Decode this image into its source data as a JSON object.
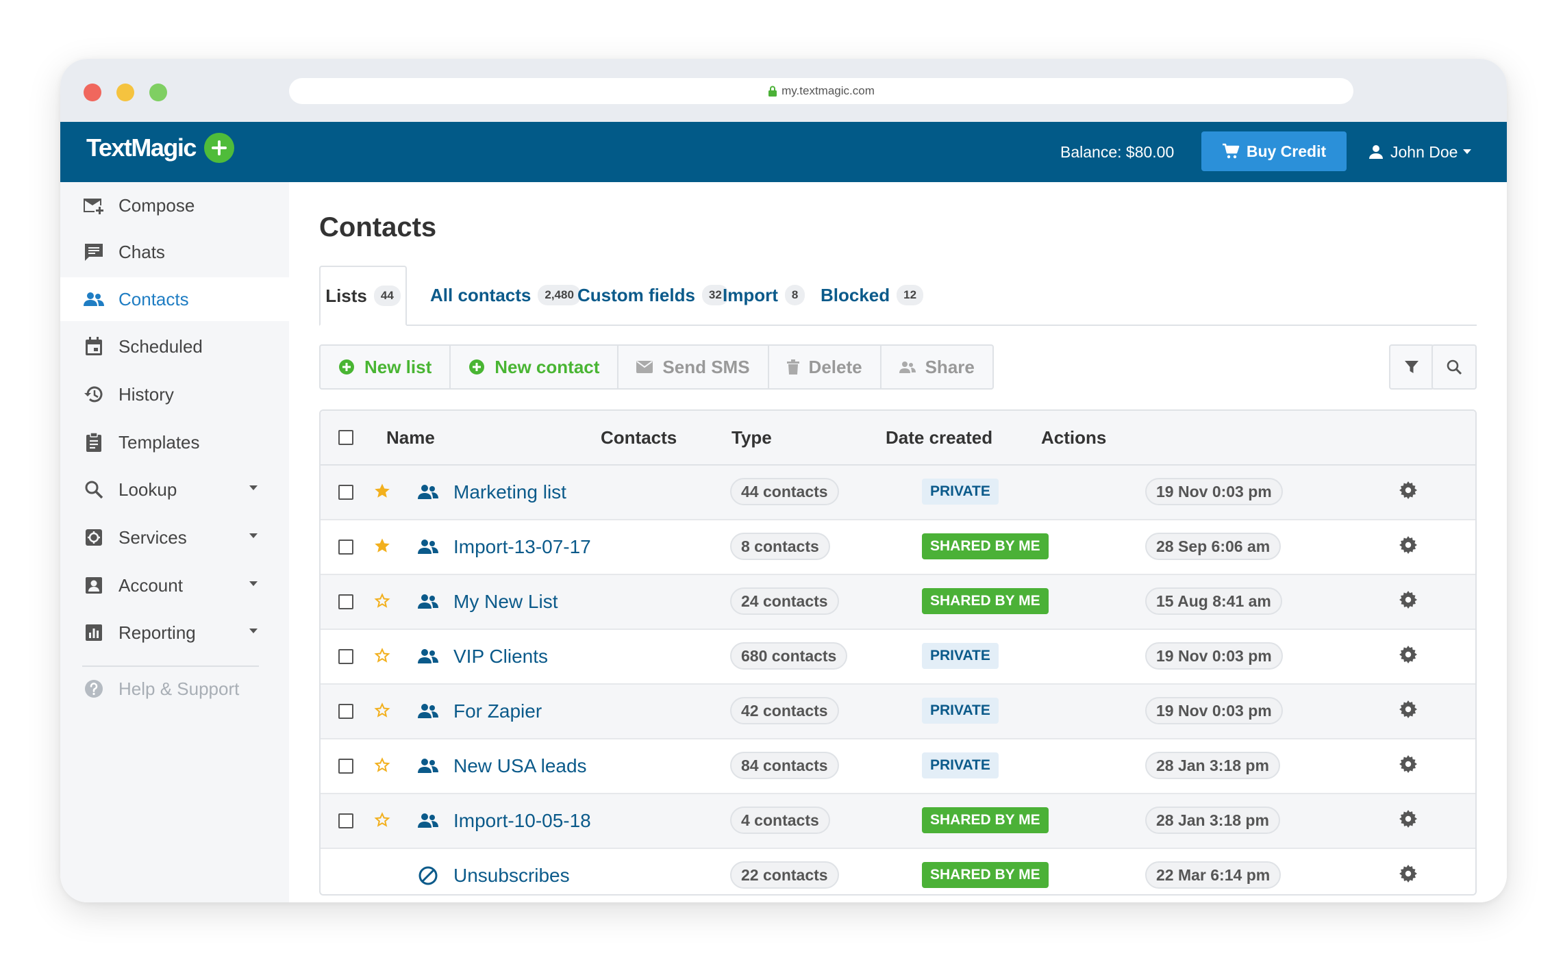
{
  "browser": {
    "url": "my.textmagic.com"
  },
  "header": {
    "logo": "TextMagic",
    "balance": "Balance: $80.00",
    "buy_credit": "Buy Credit",
    "user_name": "John Doe"
  },
  "sidebar": {
    "items": [
      {
        "label": "Compose",
        "icon": "compose-icon"
      },
      {
        "label": "Chats",
        "icon": "chat-icon"
      },
      {
        "label": "Contacts",
        "icon": "contacts-icon",
        "active": true
      },
      {
        "label": "Scheduled",
        "icon": "calendar-icon"
      },
      {
        "label": "History",
        "icon": "history-icon"
      },
      {
        "label": "Templates",
        "icon": "clipboard-icon"
      },
      {
        "label": "Lookup",
        "icon": "search-icon",
        "expandable": true
      },
      {
        "label": "Services",
        "icon": "services-icon",
        "expandable": true
      },
      {
        "label": "Account",
        "icon": "account-icon",
        "expandable": true
      },
      {
        "label": "Reporting",
        "icon": "bar-chart-icon",
        "expandable": true
      }
    ],
    "help": "Help & Support"
  },
  "main": {
    "title": "Contacts",
    "tabs": [
      {
        "label": "Lists",
        "count": "44",
        "active": true
      },
      {
        "label": "All contacts",
        "count": "2,480"
      },
      {
        "label": "Custom fields",
        "count": "32"
      },
      {
        "label": "Import",
        "count": "8"
      },
      {
        "label": "Blocked",
        "count": "12"
      }
    ],
    "toolbar": {
      "new_list": "New list",
      "new_contact": "New contact",
      "send_sms": "Send SMS",
      "delete": "Delete",
      "share": "Share"
    },
    "table": {
      "headers": {
        "name": "Name",
        "contacts": "Contacts",
        "type": "Type",
        "date": "Date created",
        "actions": "Actions"
      },
      "rows": [
        {
          "name": "Marketing list",
          "starred": true,
          "contacts": "44 contacts",
          "type": "PRIVATE",
          "date": "19 Nov 0:03 pm"
        },
        {
          "name": "Import-13-07-17",
          "starred": true,
          "contacts": "8 contacts",
          "type": "SHARED BY ME",
          "date": "28 Sep 6:06 am"
        },
        {
          "name": "My New List",
          "starred": false,
          "contacts": "24 contacts",
          "type": "SHARED BY ME",
          "date": "15 Aug 8:41 am"
        },
        {
          "name": "VIP Clients",
          "starred": false,
          "contacts": "680 contacts",
          "type": "PRIVATE",
          "date": "19 Nov 0:03 pm"
        },
        {
          "name": "For Zapier",
          "starred": false,
          "contacts": "42 contacts",
          "type": "PRIVATE",
          "date": "19 Nov 0:03 pm"
        },
        {
          "name": "New USA leads",
          "starred": false,
          "contacts": "84 contacts",
          "type": "PRIVATE",
          "date": "28 Jan 3:18 pm"
        },
        {
          "name": "Import-10-05-18",
          "starred": false,
          "contacts": "4 contacts",
          "type": "SHARED BY ME",
          "date": "28 Jan 3:18 pm"
        },
        {
          "name": "Unsubscribes",
          "special": true,
          "contacts": "22 contacts",
          "type": "SHARED BY ME",
          "date": "22 Mar 6:14 pm"
        }
      ]
    }
  },
  "colors": {
    "header_bg": "#025a88",
    "accent": "#1f7dc3",
    "green": "#4bb137",
    "star": "#f2b01e"
  }
}
